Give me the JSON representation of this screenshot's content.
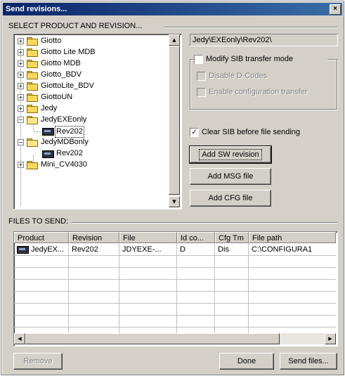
{
  "window": {
    "title": "Send revisions...",
    "close_glyph": "×"
  },
  "select_group": {
    "label": "SELECT PRODUCT AND REVISION..."
  },
  "tree": {
    "items": [
      {
        "label": "Giotto",
        "expander": "+",
        "icon": "folder-icon"
      },
      {
        "label": "Giotto Lite MDB",
        "expander": "+",
        "icon": "folder-icon"
      },
      {
        "label": "Giotto MDB",
        "expander": "+",
        "icon": "folder-icon"
      },
      {
        "label": "Giotto_BDV",
        "expander": "+",
        "icon": "folder-icon"
      },
      {
        "label": "GiottoLite_BDV",
        "expander": "+",
        "icon": "folder-icon"
      },
      {
        "label": "GiottoUN",
        "expander": "+",
        "icon": "folder-icon"
      },
      {
        "label": "Jedy",
        "expander": "+",
        "icon": "folder-icon"
      },
      {
        "label": "JedyEXEonly",
        "expander": "−",
        "icon": "open-folder-icon"
      },
      {
        "label": "Rev202",
        "icon": "revision-icon",
        "selected": true
      },
      {
        "label": "JedyMDBonly",
        "expander": "−",
        "icon": "open-folder-icon"
      },
      {
        "label": "Rev202",
        "icon": "revision-icon"
      },
      {
        "label": "Mini_CV4030",
        "expander": "+",
        "icon": "folder-icon"
      }
    ],
    "scroll_up": "▲",
    "scroll_down": "▼"
  },
  "path_field": {
    "value": "Jedy\\EXEonly\\Rev202\\"
  },
  "modify_sib": {
    "label": "Modify SIB transfer mode",
    "checked": false
  },
  "disable_options": [
    {
      "label": "Disable D-Codes",
      "checked": false
    },
    {
      "label": "Enable configuration transfer",
      "checked": false
    }
  ],
  "clear_sib": {
    "label": "Clear SIB before file sending",
    "checked": true,
    "check_glyph": "✓"
  },
  "buttons": {
    "add_sw": "Add SW revision",
    "add_msg": "Add MSG file",
    "add_cfg": "Add CFG file",
    "remove": "Remove",
    "done": "Done",
    "send": "Send files..."
  },
  "files_group": {
    "label": "FILES TO SEND:"
  },
  "files_table": {
    "columns": [
      "Product",
      "Revision",
      "File",
      "Id co...",
      "Cfg Tm",
      "File path"
    ],
    "rows": [
      {
        "product": "JedyEX...",
        "revision": "Rev202",
        "file": "JDYEXE-...",
        "id": "D",
        "cfg": "Dis",
        "path": "C:\\CONFIGURA1"
      }
    ],
    "scroll_left": "◀",
    "scroll_right": "▶"
  }
}
